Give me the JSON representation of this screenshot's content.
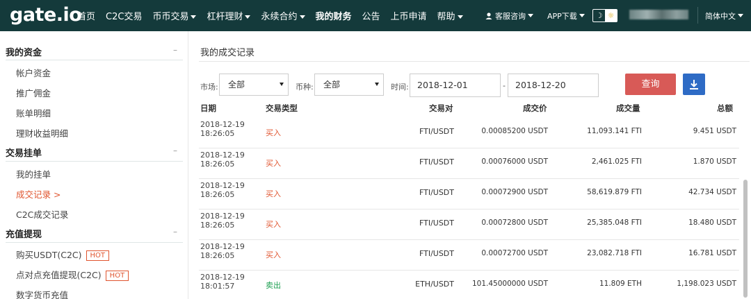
{
  "brand": {
    "logo": "gate.io"
  },
  "nav": {
    "items": [
      {
        "label": "首页",
        "dropdown": false,
        "bold": false
      },
      {
        "label": "C2C交易",
        "dropdown": false,
        "bold": false
      },
      {
        "label": "币币交易",
        "dropdown": true,
        "bold": false
      },
      {
        "label": "杠杆理财",
        "dropdown": true,
        "bold": false
      },
      {
        "label": "永续合约",
        "dropdown": true,
        "bold": false
      },
      {
        "label": "我的财务",
        "dropdown": false,
        "bold": true
      },
      {
        "label": "公告",
        "dropdown": false,
        "bold": false
      },
      {
        "label": "上币申请",
        "dropdown": false,
        "bold": false
      },
      {
        "label": "帮助",
        "dropdown": true,
        "bold": false
      }
    ],
    "service": "客服咨询",
    "app": "APP下载",
    "theme_moon": "☽",
    "theme_sun": "☼",
    "language": "简体中文"
  },
  "sidebar": {
    "sections": [
      {
        "title": "我的资金",
        "collapse": "–",
        "items": [
          "帐户资金",
          "推广佣金",
          "账单明细",
          "理财收益明细"
        ]
      },
      {
        "title": "交易挂单",
        "collapse": "–",
        "items": [
          "我的挂单",
          "成交记录  >",
          "C2C成交记录"
        ]
      },
      {
        "title": "充值提现",
        "collapse": "–",
        "items": [
          "购买USDT(C2C)",
          "点对点充值提现(C2C)",
          "数字货币充值"
        ]
      }
    ],
    "hot_label": "HOT"
  },
  "main": {
    "title": "我的成交记录",
    "filters": {
      "market_label": "市场:",
      "market_value": "全部",
      "coin_label": "币种:",
      "coin_value": "全部",
      "time_label": "时间:",
      "date_from": "2018-12-01",
      "date_sep": "-",
      "date_to": "2018-12-20",
      "query_button": "查询"
    },
    "table": {
      "headers": [
        "日期",
        "交易类型",
        "交易对",
        "成交价",
        "成交量",
        "总额"
      ],
      "rows": [
        {
          "date": "2018-12-19",
          "time": "18:26:05",
          "type": "买入",
          "side": "buy",
          "pair": "FTI/USDT",
          "price": "0.00085200 USDT",
          "volume": "11,093.141 FTI",
          "total": "9.451 USDT"
        },
        {
          "date": "2018-12-19",
          "time": "18:26:05",
          "type": "买入",
          "side": "buy",
          "pair": "FTI/USDT",
          "price": "0.00076000 USDT",
          "volume": "2,461.025 FTI",
          "total": "1.870 USDT"
        },
        {
          "date": "2018-12-19",
          "time": "18:26:05",
          "type": "买入",
          "side": "buy",
          "pair": "FTI/USDT",
          "price": "0.00072900 USDT",
          "volume": "58,619.879 FTI",
          "total": "42.734 USDT"
        },
        {
          "date": "2018-12-19",
          "time": "18:26:05",
          "type": "买入",
          "side": "buy",
          "pair": "FTI/USDT",
          "price": "0.00072800 USDT",
          "volume": "25,385.048 FTI",
          "total": "18.480 USDT"
        },
        {
          "date": "2018-12-19",
          "time": "18:26:05",
          "type": "买入",
          "side": "buy",
          "pair": "FTI/USDT",
          "price": "0.00072700 USDT",
          "volume": "23,082.718 FTI",
          "total": "16.781 USDT"
        },
        {
          "date": "2018-12-19",
          "time": "18:01:57",
          "type": "卖出",
          "side": "sell",
          "pair": "ETH/USDT",
          "price": "101.45000000 USDT",
          "volume": "11.809 ETH",
          "total": "1,198.023 USDT"
        }
      ]
    }
  },
  "colors": {
    "nav_bg": "#143a3b",
    "buy": "#e0542e",
    "sell": "#1c9f50",
    "query_button": "#d85a57",
    "download_button": "#2e6bc5"
  }
}
